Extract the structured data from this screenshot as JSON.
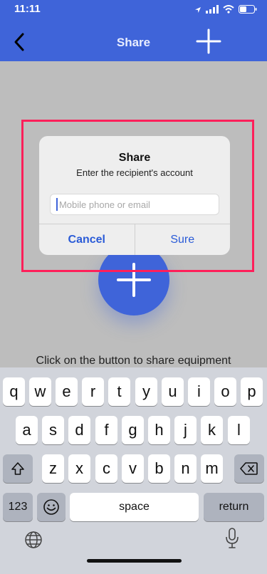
{
  "status_bar": {
    "time": "11:11"
  },
  "nav": {
    "title": "Share"
  },
  "main": {
    "hint": "Click on the button to share equipment"
  },
  "dialog": {
    "title": "Share",
    "message": "Enter the recipient's account",
    "input_placeholder": "Mobile phone or email",
    "input_value": "",
    "cancel_label": "Cancel",
    "confirm_label": "Sure"
  },
  "keyboard": {
    "row1": [
      "q",
      "w",
      "e",
      "r",
      "t",
      "y",
      "u",
      "i",
      "o",
      "p"
    ],
    "row2": [
      "a",
      "s",
      "d",
      "f",
      "g",
      "h",
      "j",
      "k",
      "l"
    ],
    "row3": [
      "z",
      "x",
      "c",
      "v",
      "b",
      "n",
      "m"
    ],
    "numbers_label": "123",
    "space_label": "space",
    "return_label": "return"
  },
  "colors": {
    "accent": "#3f64d9",
    "highlight": "#ff1f5a",
    "button_text": "#2a5bd7"
  }
}
